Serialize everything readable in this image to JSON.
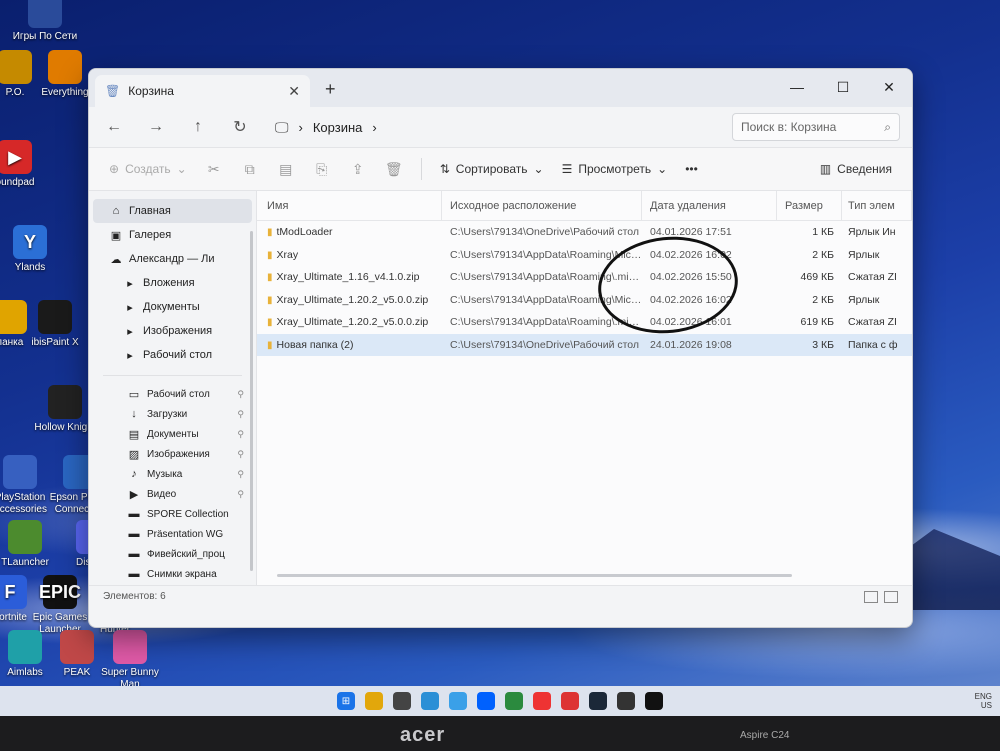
{
  "desktop_icons": [
    {
      "label": "Игры По Сети",
      "glyph": "",
      "color": "#2a4b9a"
    },
    {
      "label": "P.O.",
      "glyph": "",
      "color": "#c58a00"
    },
    {
      "label": "Everything",
      "glyph": "",
      "color": "#e07b00"
    },
    {
      "label": "oundpad",
      "glyph": "▶",
      "color": "#d62828"
    },
    {
      "label": "Ylands",
      "glyph": "Y",
      "color": "#2b6fd6"
    },
    {
      "label": "панка",
      "glyph": "",
      "color": "#e0a400"
    },
    {
      "label": "ibisPaint X",
      "glyph": "",
      "color": "#1a1a1a"
    },
    {
      "label": "Hollow Knight",
      "glyph": "",
      "color": "#222"
    },
    {
      "label": "PlayStation Accessories",
      "glyph": "",
      "color": "#3760c0"
    },
    {
      "label": "Epson Printer Connection",
      "glyph": "",
      "color": "#2a66c2"
    },
    {
      "label": "TLauncher",
      "glyph": "",
      "color": "#4c8b2e"
    },
    {
      "label": "Discord",
      "glyph": "",
      "color": "#5865f2"
    },
    {
      "label": "Fortnite",
      "glyph": "F",
      "color": "#2b5dd9"
    },
    {
      "label": "Epic Games Launcher",
      "glyph": "EPIC",
      "color": "#111"
    },
    {
      "label": "Way of the Hunter",
      "glyph": "",
      "color": "#4a4a3a"
    },
    {
      "label": "Aimlabs",
      "glyph": "",
      "color": "#1fa0a8"
    },
    {
      "label": "PEAK",
      "glyph": "",
      "color": "#c04848"
    },
    {
      "label": "Super Bunny Man",
      "glyph": "",
      "color": "#e05aa8"
    }
  ],
  "window": {
    "tab_title": "Корзина",
    "new_tab": "+",
    "minimize": "—",
    "maximize": "☐",
    "close": "✕"
  },
  "nav": {
    "back": "←",
    "forward": "→",
    "up": "↑",
    "refresh": "↻",
    "breadcrumb": "Корзина",
    "search_placeholder": "Поиск в: Корзина"
  },
  "toolbar": {
    "create": "Создать",
    "sort": "Сортировать",
    "view": "Просмотреть",
    "more": "•••",
    "details": "Сведения"
  },
  "sidebar": {
    "top": [
      {
        "label": "Главная",
        "icon": "⌂",
        "active": true
      },
      {
        "label": "Галерея",
        "icon": "▣",
        "active": false
      },
      {
        "label": "Александр — Ли",
        "icon": "☁",
        "active": false
      }
    ],
    "tree": [
      {
        "label": "Вложения"
      },
      {
        "label": "Документы"
      },
      {
        "label": "Изображения"
      },
      {
        "label": "Рабочий стол"
      }
    ],
    "quick": [
      {
        "label": "Рабочий стол",
        "icon": "▭"
      },
      {
        "label": "Загрузки",
        "icon": "↓"
      },
      {
        "label": "Документы",
        "icon": "▤"
      },
      {
        "label": "Изображения",
        "icon": "▨"
      },
      {
        "label": "Музыка",
        "icon": "♪"
      },
      {
        "label": "Видео",
        "icon": "▶"
      },
      {
        "label": "SPORE Collection",
        "icon": "▬"
      },
      {
        "label": "Präsentation WG",
        "icon": "▬"
      },
      {
        "label": "Фивейский_проц",
        "icon": "▬"
      },
      {
        "label": "Снимки экрана",
        "icon": "▬"
      }
    ]
  },
  "columns": {
    "name": "Имя",
    "orig": "Исходное расположение",
    "date": "Дата удаления",
    "size": "Размер",
    "type": "Тип элем"
  },
  "files": [
    {
      "name": "tModLoader",
      "orig": "C:\\Users\\79134\\OneDrive\\Рабочий стол",
      "date": "04.01.2026 17:51",
      "size": "1 КБ",
      "type": "Ярлык Ин",
      "selected": false
    },
    {
      "name": "Xray",
      "orig": "C:\\Users\\79134\\AppData\\Roaming\\Micr...",
      "date": "04.02.2026 16:02",
      "size": "2 КБ",
      "type": "Ярлык",
      "selected": false
    },
    {
      "name": "Xray_Ultimate_1.16_v4.1.0.zip",
      "orig": "C:\\Users\\79134\\AppData\\Roaming\\.min...",
      "date": "04.02.2026 15:50",
      "size": "469 КБ",
      "type": "Сжатая ZI",
      "selected": false
    },
    {
      "name": "Xray_Ultimate_1.20.2_v5.0.0.zip",
      "orig": "C:\\Users\\79134\\AppData\\Roaming\\Micr...",
      "date": "04.02.2026 16:02",
      "size": "2 КБ",
      "type": "Ярлык",
      "selected": false
    },
    {
      "name": "Xray_Ultimate_1.20.2_v5.0.0.zip",
      "orig": "C:\\Users\\79134\\AppData\\Roaming\\.min...",
      "date": "04.02.2026 16:01",
      "size": "619 КБ",
      "type": "Сжатая ZI",
      "selected": false
    },
    {
      "name": "Новая папка (2)",
      "orig": "C:\\Users\\79134\\OneDrive\\Рабочий стол",
      "date": "24.01.2026 19:08",
      "size": "3 КБ",
      "type": "Папка с ф",
      "selected": true
    }
  ],
  "status": {
    "count": "Элементов: 6"
  },
  "tray": {
    "lang": "ENG",
    "sub": "US"
  },
  "bezel": {
    "brand": "acer",
    "model": "Aspire C24"
  }
}
